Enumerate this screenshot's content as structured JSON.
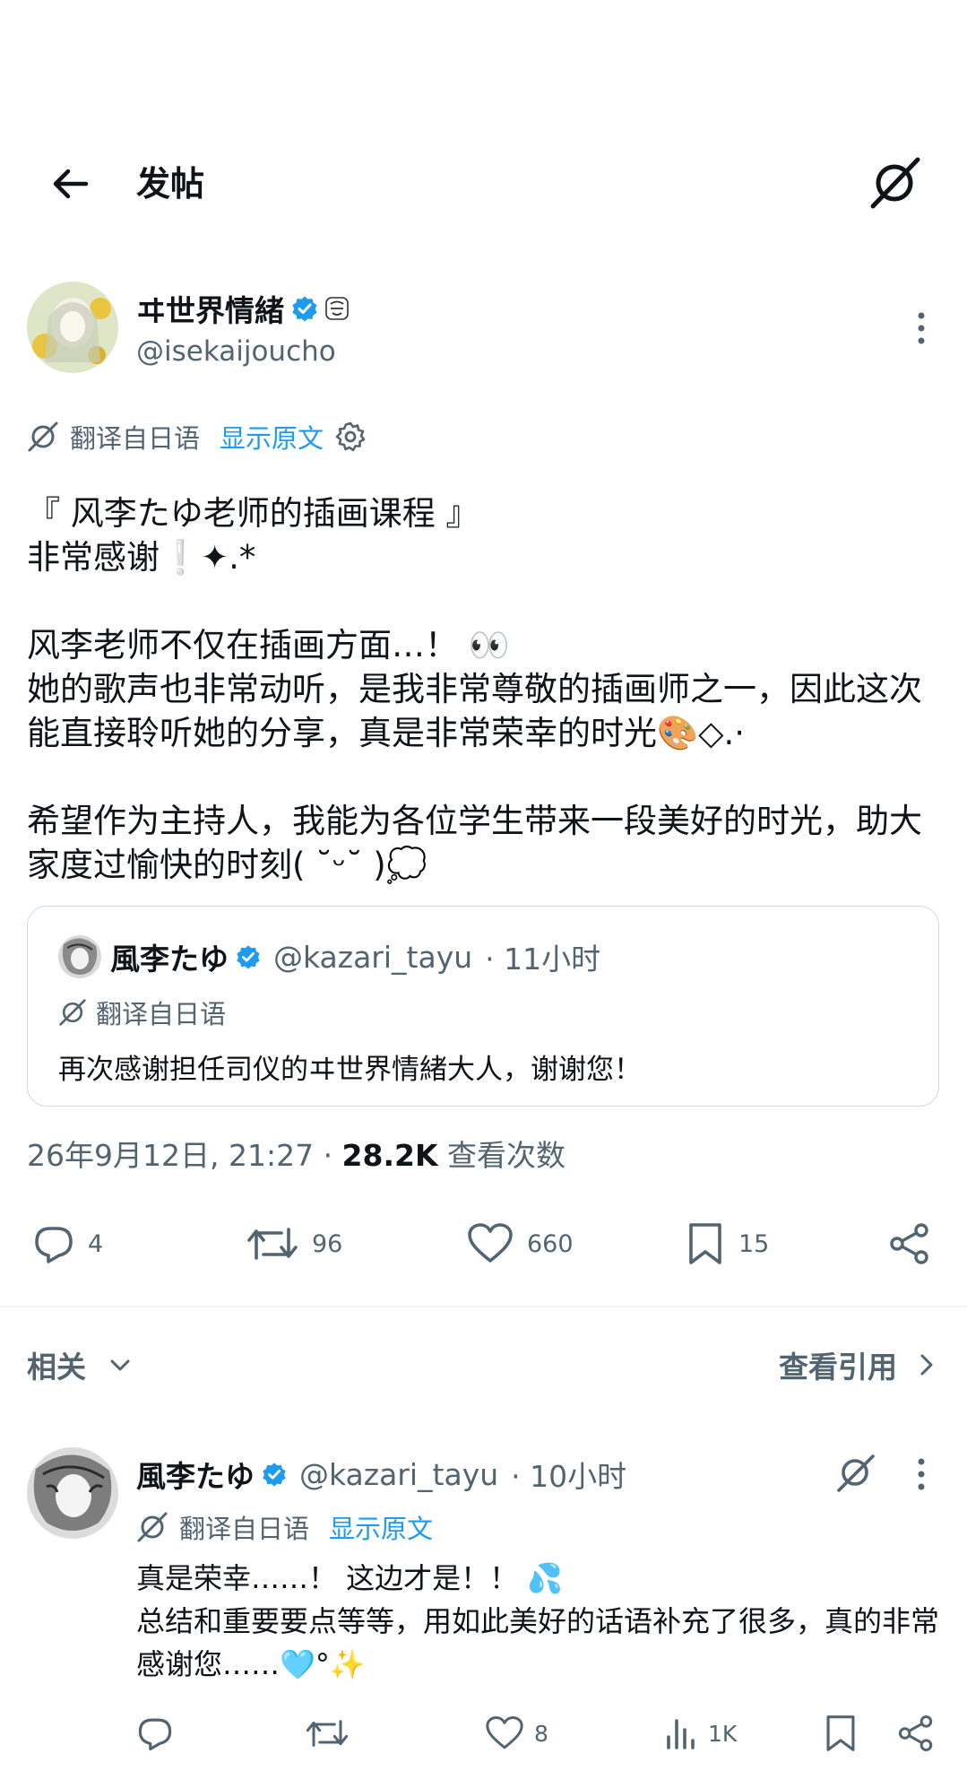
{
  "header": {
    "title": "发帖"
  },
  "post": {
    "author_name": "ヰ世界情緒",
    "author_handle": "@isekaijoucho",
    "translate_label": "翻译自日语",
    "show_original": "显示原文",
    "body": "『 风李たゆ老师的插画课程 』\n非常感谢❕✦.*\n\n风李老师不仅在插画方面…！ 👀\n她的歌声也非常动听，是我非常尊敬的插画师之一，因此这次能直接聆听她的分享，真是非常荣幸的时光🎨◇.·\n\n希望作为主持人，我能为各位学生带来一段美好的时光，助大家度过愉快的时刻( ˘ᵕ˘ )💭",
    "timestamp": "26年9月12日, 21:27",
    "views_count": "28.2K",
    "views_label": "查看次数"
  },
  "quote": {
    "author_name": "風李たゆ",
    "author_handle": "@kazari_tayu",
    "time": "· 11小时",
    "translate_label": "翻译自日语",
    "text": "再次感谢担任司仪的ヰ世界情緒大人，谢谢您！"
  },
  "actions": {
    "replies": "4",
    "reposts": "96",
    "likes": "660",
    "bookmarks": "15"
  },
  "related": {
    "label": "相关",
    "view_quotes": "查看引用"
  },
  "reply": {
    "author_name": "風李たゆ",
    "author_handle": "@kazari_tayu",
    "time": "· 10小时",
    "translate_label": "翻译自日语",
    "show_original": "显示原文",
    "body": "真是荣幸……！ 这边才是！！ 💦\n总结和重要要点等等，用如此美好的话语补充了很多，真的非常感谢您……🩵°✨",
    "replies": "",
    "reposts": "",
    "likes": "8",
    "views": "1K"
  },
  "colors": {
    "text": "#0f1419",
    "secondary": "#536471",
    "link": "#1d9bf0",
    "verified": "#1d9bf0",
    "border": "#cfd9de"
  }
}
